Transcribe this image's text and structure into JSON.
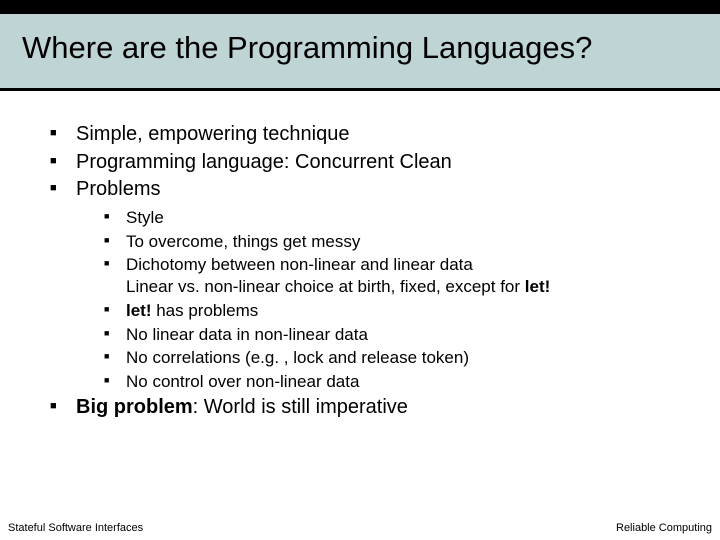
{
  "title": "Where are the Programming Languages?",
  "bullets": {
    "b1": "Simple, empowering technique",
    "b2": "Programming language: Concurrent Clean",
    "b3": "Problems",
    "sub": {
      "s1": "Style",
      "s2": "To overcome, things get messy",
      "s3a": "Dichotomy between non-linear and linear data",
      "s3b_pre": "Linear vs. non-linear choice at birth, fixed, except for ",
      "s3b_bold": "let!",
      "s4_bold": "let!",
      "s4_rest": " has problems",
      "s5": "No linear data in non-linear data",
      "s6": "No correlations (e.g. , lock and release token)",
      "s7": "No control over non-linear data"
    },
    "b4_bold": "Big problem",
    "b4_rest": ": World is still imperative"
  },
  "footer": {
    "left": "Stateful Software Interfaces",
    "right": "Reliable Computing"
  }
}
